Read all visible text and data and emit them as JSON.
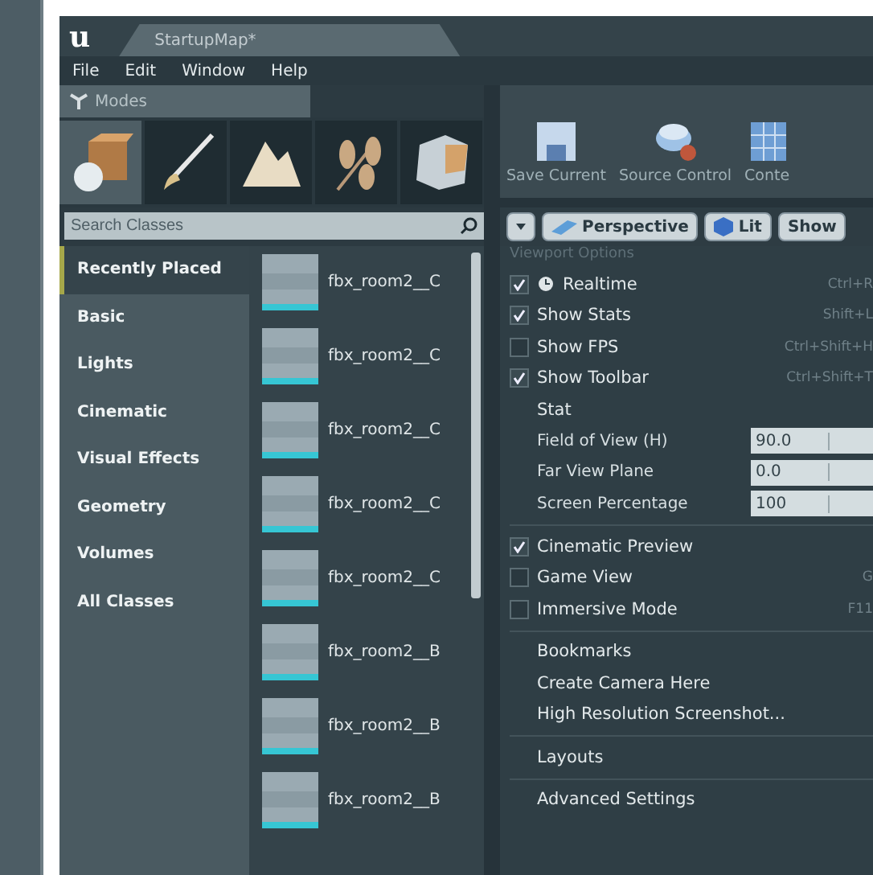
{
  "logo": "u",
  "title_tab": "StartupMap*",
  "menu": [
    "File",
    "Edit",
    "Window",
    "Help"
  ],
  "modes_tab": "Modes",
  "mode_tools": [
    {
      "kind": "place",
      "selected": true
    },
    {
      "kind": "paint",
      "selected": false
    },
    {
      "kind": "landscape",
      "selected": false
    },
    {
      "kind": "foliage",
      "selected": false
    },
    {
      "kind": "geometry",
      "selected": false
    }
  ],
  "search": {
    "placeholder": "Search Classes"
  },
  "categories": [
    {
      "label": "Recently Placed",
      "selected": true
    },
    {
      "label": "Basic",
      "selected": false
    },
    {
      "label": "Lights",
      "selected": false
    },
    {
      "label": "Cinematic",
      "selected": false
    },
    {
      "label": "Visual Effects",
      "selected": false
    },
    {
      "label": "Geometry",
      "selected": false
    },
    {
      "label": "Volumes",
      "selected": false
    },
    {
      "label": "All Classes",
      "selected": false
    }
  ],
  "assets": [
    {
      "name": "fbx_room2__C"
    },
    {
      "name": "fbx_room2__C"
    },
    {
      "name": "fbx_room2__C"
    },
    {
      "name": "fbx_room2__C"
    },
    {
      "name": "fbx_room2__C"
    },
    {
      "name": "fbx_room2__B"
    },
    {
      "name": "fbx_room2__B"
    },
    {
      "name": "fbx_room2__B"
    }
  ],
  "toolbar": [
    {
      "label": "Save Current",
      "kind": "save"
    },
    {
      "label": "Source Control",
      "kind": "source"
    },
    {
      "label": "Conte",
      "kind": "content"
    }
  ],
  "viewport_buttons": [
    {
      "label": "Perspective",
      "kind": "perspective"
    },
    {
      "label": "Lit",
      "kind": "lit"
    },
    {
      "label": "Show",
      "kind": "plain"
    }
  ],
  "viewport_menu": {
    "heading": "Viewport Options",
    "items": [
      {
        "kind": "check",
        "label": "Realtime",
        "checked": true,
        "icon": true,
        "shortcut": "Ctrl+R"
      },
      {
        "kind": "check",
        "label": "Show Stats",
        "checked": true,
        "shortcut": "Shift+L"
      },
      {
        "kind": "check",
        "label": "Show FPS",
        "checked": false,
        "shortcut": "Ctrl+Shift+H"
      },
      {
        "kind": "check",
        "label": "Show Toolbar",
        "checked": true,
        "shortcut": "Ctrl+Shift+T"
      },
      {
        "kind": "plain",
        "label": "Stat"
      },
      {
        "kind": "field",
        "label": "Field of View (H)",
        "value": "90.0"
      },
      {
        "kind": "field",
        "label": "Far View Plane",
        "value": "0.0"
      },
      {
        "kind": "field",
        "label": "Screen Percentage",
        "value": "100"
      },
      {
        "kind": "separator"
      },
      {
        "kind": "check",
        "label": "Cinematic Preview",
        "checked": true
      },
      {
        "kind": "check",
        "label": "Game View",
        "checked": false,
        "shortcut": "G"
      },
      {
        "kind": "check",
        "label": "Immersive Mode",
        "checked": false,
        "shortcut": "F11"
      },
      {
        "kind": "separator"
      },
      {
        "kind": "plain",
        "label": "Bookmarks"
      },
      {
        "kind": "plain",
        "label": "Create Camera Here"
      },
      {
        "kind": "plain",
        "label": "High Resolution Screenshot..."
      },
      {
        "kind": "separator"
      },
      {
        "kind": "plain",
        "label": "Layouts"
      },
      {
        "kind": "separator"
      },
      {
        "kind": "plain",
        "label": "Advanced Settings"
      }
    ]
  }
}
